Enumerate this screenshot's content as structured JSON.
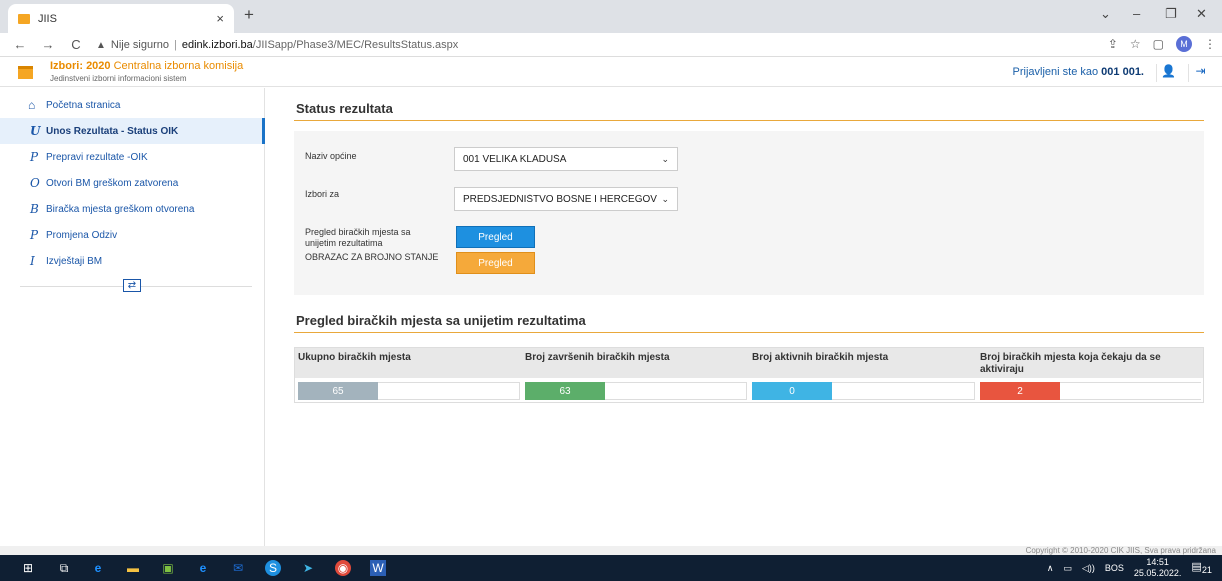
{
  "browser": {
    "tab_title": "JIIS",
    "tab_close": "×",
    "new_tab": "+",
    "warning_icon": "▲",
    "insecure_label": "Nije sigurno",
    "separator": "|",
    "url_host": "edink.izbori.ba",
    "url_path": "/JIISapp/Phase3/MEC/ResultsStatus.aspx",
    "profile_initial": "M"
  },
  "header": {
    "title_prefix": "Izbori:",
    "title_year": "2020",
    "title_org": "Centralna izborna komisija",
    "subtitle": "Jedinstveni izborni informacioni sistem",
    "login_prefix": "Prijavljeni ste kao",
    "login_user": "001 001."
  },
  "sidebar": {
    "home": "Početna stranica",
    "items": [
      {
        "letter": "U",
        "label": "Unos Rezultata - Status OIK",
        "active": true
      },
      {
        "letter": "P",
        "label": "Prepravi rezultate -OIK"
      },
      {
        "letter": "O",
        "label": "Otvori BM greškom zatvorena"
      },
      {
        "letter": "B",
        "label": "Biračka mjesta greškom otvorena"
      },
      {
        "letter": "P",
        "label": "Promjena Odziv"
      },
      {
        "letter": "I",
        "label": "Izvještaji BM"
      }
    ]
  },
  "main": {
    "status_title": "Status rezultata",
    "form": {
      "opcina_label": "Naziv općine",
      "opcina_value": "001 VELIKA KLADUŠA",
      "izbori_label": "Izbori za",
      "izbori_value": "PREDSJEDNIŠTVO BOSNE I HERCEGOVINE",
      "pregled_label_1": "Pregled biračkih mjesta sa",
      "pregled_label_2": "unijetim rezultatima",
      "obrazac_label": "OBRAZAC ZA BROJNO STANJE",
      "pregled_btn": "Pregled",
      "obrazac_btn": "Pregled"
    },
    "overview_title": "Pregled biračkih mjesta sa unijetim rezultatima",
    "stats": [
      {
        "header": "Ukupno biračkih mjesta",
        "value": "65",
        "color": "#a3b3bd"
      },
      {
        "header": "Broj završenih biračkih mjesta",
        "value": "63",
        "color": "#5cae6a"
      },
      {
        "header": "Broj aktivnih biračkih mjesta",
        "value": "0",
        "color": "#3fb4e4"
      },
      {
        "header_1": "Broj biračkih mjesta koja čekaju da se",
        "header_2": "aktiviraju",
        "value": "2",
        "color": "#e8553f"
      }
    ]
  },
  "footer": {
    "copyright": "Copyright © 2010-2020 CIK JIIS, Sva prava pridržana"
  },
  "taskbar": {
    "lang": "BOS",
    "time": "14:51",
    "date": "25.05.2022.",
    "notif_count": "21"
  }
}
